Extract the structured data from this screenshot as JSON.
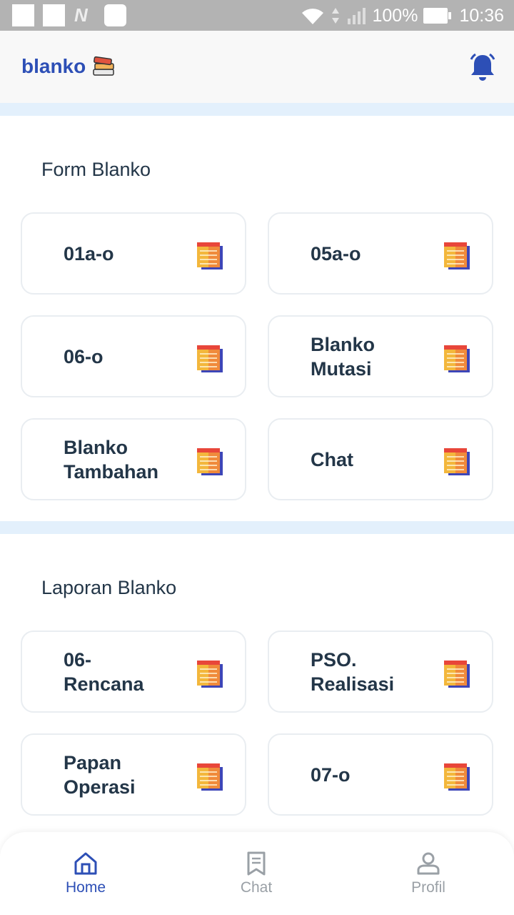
{
  "status_bar": {
    "battery": "100%",
    "time": "10:36"
  },
  "app_bar": {
    "brand": "blanko"
  },
  "sections": [
    {
      "title": "Form Blanko",
      "items": [
        "01a-o",
        "05a-o",
        "06-o",
        "Blanko Mutasi",
        "Blanko Tambahan",
        "Chat"
      ]
    },
    {
      "title": "Laporan Blanko",
      "items": [
        "06-Rencana",
        "PSO. Realisasi",
        "Papan Operasi",
        "07-o"
      ]
    }
  ],
  "labels": {
    "s0_0": "01a-o",
    "s0_1": "05a-o",
    "s0_2": "06-o",
    "s0_3": "Blanko Mutasi",
    "s0_4": "Blanko Tambahan",
    "s0_5": "Chat",
    "s1_0": "06-Rencana",
    "s1_1": "PSO. Realisasi",
    "s1_2": "Papan Operasi",
    "s1_3": "07-o"
  },
  "bottom_nav": [
    {
      "label": "Home",
      "icon": "home-icon",
      "active": true
    },
    {
      "label": "Chat",
      "icon": "chat-icon",
      "active": false
    },
    {
      "label": "Profil",
      "icon": "profile-icon",
      "active": false
    }
  ],
  "colors": {
    "accent": "#2d4fb6",
    "divider": "#e3f0fc",
    "text": "#233648",
    "inactive": "#9aa0a6"
  }
}
